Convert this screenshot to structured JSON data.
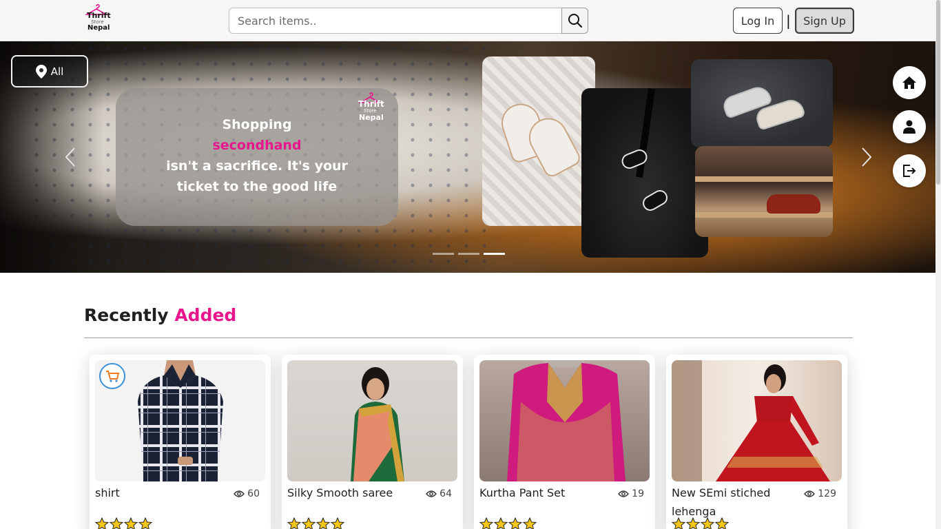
{
  "header": {
    "logo_line1": "Thrift",
    "logo_line2": "Store",
    "logo_line3": "Nepal",
    "search_placeholder": "Search items..",
    "login_label": "Log In",
    "separator": "|",
    "signup_label": "Sign Up"
  },
  "hero": {
    "location_label": "All",
    "promo_line1": "Shopping",
    "promo_line2": "secondhand",
    "promo_line3": "isn't a sacrifice. It's your",
    "promo_line4": "ticket to the good life",
    "promo_logo_line1": "Thrift",
    "promo_logo_line2": "Store",
    "promo_logo_line3": "Nepal",
    "slide_count": 3,
    "active_slide": 3,
    "accent_color": "#e8158c"
  },
  "side_nav": [
    {
      "icon": "home-icon"
    },
    {
      "icon": "user-icon"
    },
    {
      "icon": "logout-icon"
    }
  ],
  "recent": {
    "title_prefix": "Recently",
    "title_accent": "Added",
    "items": [
      {
        "name": "shirt",
        "views": "60",
        "rating": 4
      },
      {
        "name": "Silky Smooth saree",
        "views": "64",
        "rating": 4
      },
      {
        "name": "Kurtha Pant Set",
        "views": "19",
        "rating": 4
      },
      {
        "name": "New SEmi stiched lehenga",
        "views": "129",
        "rating": 4
      }
    ]
  }
}
